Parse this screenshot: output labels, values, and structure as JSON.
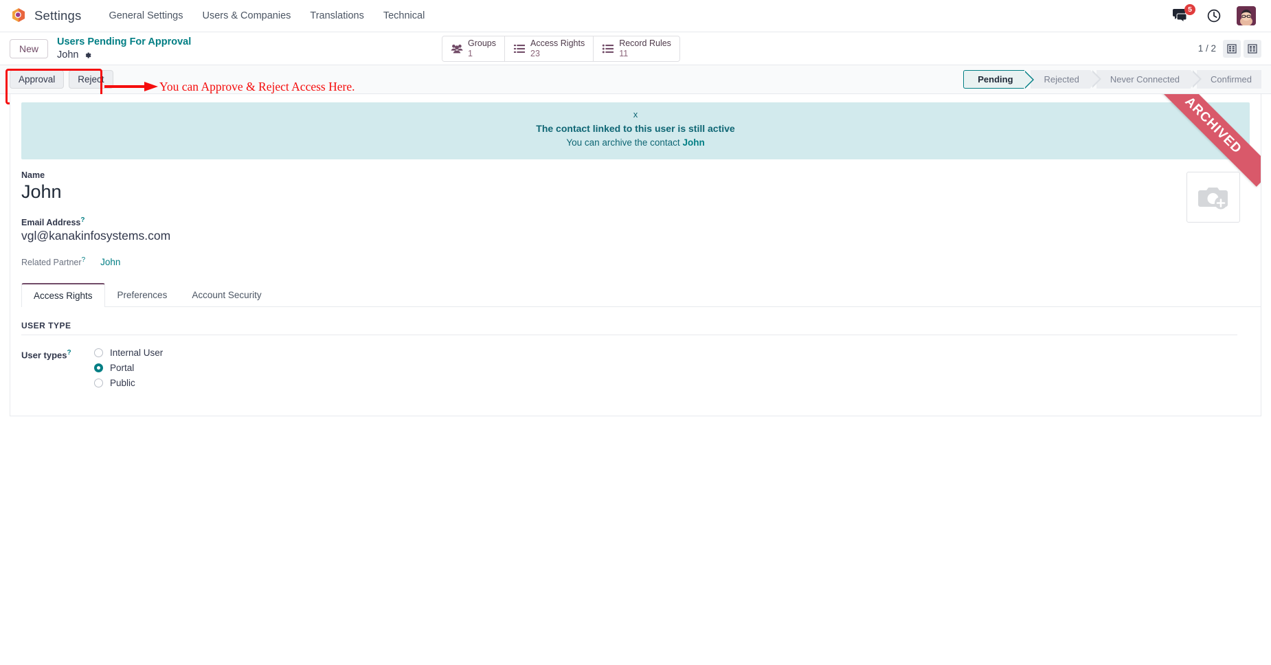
{
  "navbar": {
    "brand": "Settings",
    "menu": [
      {
        "label": "General Settings"
      },
      {
        "label": "Users & Companies"
      },
      {
        "label": "Translations"
      },
      {
        "label": "Technical"
      }
    ],
    "messages_badge": "5",
    "icons": {
      "messages": "messages-icon",
      "activity_clock": "clock-icon",
      "user_avatar": "avatar"
    }
  },
  "control_panel": {
    "new_label": "New",
    "breadcrumb_root": "Users Pending For Approval",
    "breadcrumb_record": "John",
    "stat_buttons": [
      {
        "label": "Groups",
        "value": "1",
        "icon": "users-group-icon"
      },
      {
        "label": "Access Rights",
        "value": "23",
        "icon": "list-icon"
      },
      {
        "label": "Record Rules",
        "value": "11",
        "icon": "list-dot-icon"
      }
    ],
    "pager": "1 / 2",
    "views": [
      {
        "name": "list-view-button"
      },
      {
        "name": "kanban-view-button"
      }
    ]
  },
  "actions": {
    "approval_label": "Approval",
    "reject_label": "Reject"
  },
  "annotation": {
    "text": "You can Approve & Reject Access Here.",
    "color": "#f50d0d"
  },
  "statusbar": {
    "items": [
      {
        "label": "Pending",
        "active": true
      },
      {
        "label": "Rejected",
        "active": false
      },
      {
        "label": "Never Connected",
        "active": false
      },
      {
        "label": "Confirmed",
        "active": false
      }
    ]
  },
  "ribbon": {
    "label": "ARCHIVED",
    "color": "#d9596a"
  },
  "alert": {
    "close_label": "x",
    "title": "The contact linked to this user is still active",
    "subtitle_prefix": "You can archive the contact ",
    "subtitle_link": "John",
    "background": "#d2eaed",
    "text_color": "#0f6674"
  },
  "form": {
    "name_label": "Name",
    "name_value": "John",
    "email_label": "Email Address",
    "email_value": "vgl@kanakinfosystems.com",
    "partner_label": "Related Partner",
    "partner_value": "John",
    "tooltip_marker": "?"
  },
  "tabs": [
    {
      "label": "Access Rights",
      "active": true
    },
    {
      "label": "Preferences",
      "active": false
    },
    {
      "label": "Account Security",
      "active": false
    }
  ],
  "access_rights_tab": {
    "group_title": "USER TYPE",
    "field_label": "User types",
    "options": [
      {
        "label": "Internal User",
        "checked": false
      },
      {
        "label": "Portal",
        "checked": true
      },
      {
        "label": "Public",
        "checked": false
      }
    ]
  },
  "colors": {
    "brand_purple": "#714b67",
    "teal": "#017e84",
    "annotation_red": "#f50d0d",
    "alert_bg": "#d2eaed"
  }
}
